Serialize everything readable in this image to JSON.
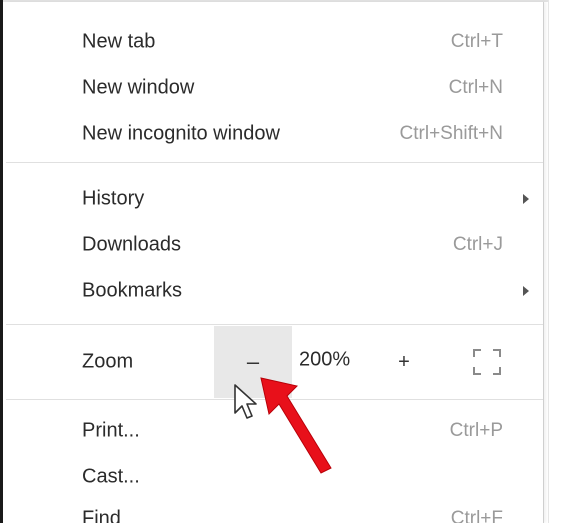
{
  "menu": {
    "new_tab": {
      "label": "New tab",
      "shortcut": "Ctrl+T"
    },
    "new_window": {
      "label": "New window",
      "shortcut": "Ctrl+N"
    },
    "new_incognito": {
      "label": "New incognito window",
      "shortcut": "Ctrl+Shift+N"
    },
    "history": {
      "label": "History"
    },
    "downloads": {
      "label": "Downloads",
      "shortcut": "Ctrl+J"
    },
    "bookmarks": {
      "label": "Bookmarks"
    },
    "zoom": {
      "label": "Zoom",
      "minus": "–",
      "value": "200%",
      "plus": "+"
    },
    "print": {
      "label": "Print...",
      "shortcut": "Ctrl+P"
    },
    "cast": {
      "label": "Cast..."
    },
    "find": {
      "label": "Find",
      "shortcut": "Ctrl+F"
    }
  },
  "icons": [
    "submenu-arrow-icon",
    "fullscreen-icon",
    "mouse-pointer-icon",
    "red-arrow-icon"
  ],
  "colors": {
    "highlight": "#e8e8e8",
    "annotation_arrow": "#e8101a",
    "shortcut_text": "#9a9a9a"
  }
}
